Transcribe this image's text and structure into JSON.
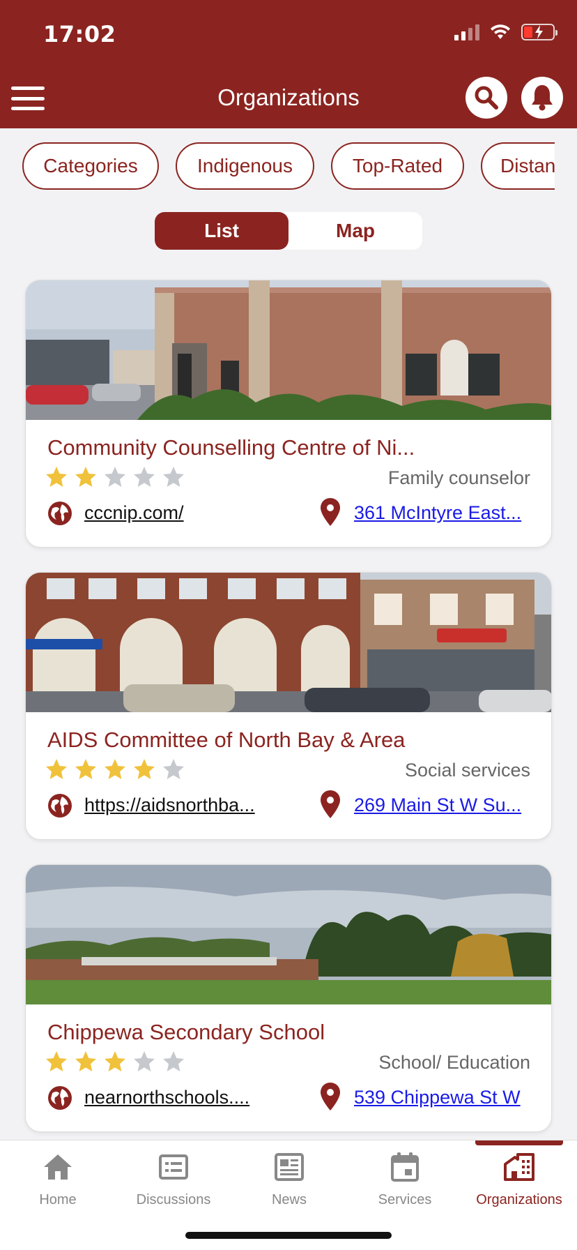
{
  "status_bar": {
    "time": "17:02"
  },
  "header": {
    "title": "Organizations"
  },
  "filters": [
    {
      "label": "Categories"
    },
    {
      "label": "Indigenous"
    },
    {
      "label": "Top-Rated"
    },
    {
      "label": "Distan"
    }
  ],
  "view_toggle": {
    "list_label": "List",
    "map_label": "Map",
    "selected": "List"
  },
  "organizations": [
    {
      "name": "Community Counselling Centre of Ni...",
      "rating": 2,
      "rating_max": 5,
      "category": "Family counselor",
      "website": "cccnip.com/",
      "address": "361 McIntyre East..."
    },
    {
      "name": "AIDS Committee of North Bay & Area",
      "rating": 4,
      "rating_max": 5,
      "category": "Social services",
      "website": "https://aidsnorthba...",
      "address": "269 Main St W Su..."
    },
    {
      "name": "Chippewa Secondary School",
      "rating": 3,
      "rating_max": 5,
      "category": "School/ Education",
      "website": "nearnorthschools....",
      "address": "539 Chippewa St W"
    }
  ],
  "tabbar": {
    "items": [
      {
        "label": "Home",
        "icon": "home-icon"
      },
      {
        "label": "Discussions",
        "icon": "discussions-icon"
      },
      {
        "label": "News",
        "icon": "news-icon"
      },
      {
        "label": "Services",
        "icon": "calendar-icon"
      },
      {
        "label": "Organizations",
        "icon": "buildings-icon"
      }
    ],
    "active": "Organizations"
  },
  "colors": {
    "brand": "#8b2420",
    "star_filled": "#f0c23b",
    "star_empty": "#c5c9ce",
    "link": "#1a1ae6"
  }
}
